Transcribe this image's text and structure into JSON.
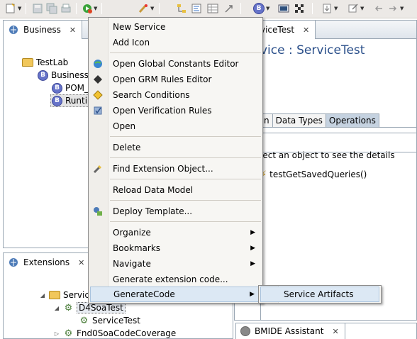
{
  "toolbar": {
    "icons": [
      "new-wizard-icon",
      "save-icon",
      "save-all-icon",
      "print-icon",
      "run-icon",
      "deploy-icon",
      "hierarchy-icon",
      "tree-icon",
      "table-icon",
      "export-icon",
      "bmide-icon",
      "console-icon",
      "checker-icon",
      "import-icon",
      "back-icon",
      "forward-icon"
    ]
  },
  "business_view": {
    "tab_title": "Business",
    "tree": [
      {
        "label": "TestLab"
      },
      {
        "label": "BusinessO"
      },
      {
        "label": "POM_"
      },
      {
        "label": "Runtin"
      }
    ]
  },
  "editor": {
    "tab_title": "viceTest",
    "header": "vice : ServiceTest",
    "tabs": [
      {
        "label": "n"
      },
      {
        "label": "Data Types"
      },
      {
        "label": "Operations"
      }
    ],
    "hint": "lect an object to see the details",
    "operation": "testGetSavedQueries()"
  },
  "extensions_view": {
    "tab_title": "Extensions",
    "tree": [
      {
        "label": "Servic"
      },
      {
        "label": "D4SoaTest"
      },
      {
        "label": "ServiceTest"
      },
      {
        "label": "Fnd0SoaCodeCoverage"
      }
    ]
  },
  "bmide_view": {
    "tab_title": "BMIDE Assistant"
  },
  "context_menu": {
    "items": [
      {
        "label": "New Service"
      },
      {
        "label": "Add Icon"
      },
      {
        "label": "Open Global Constants Editor"
      },
      {
        "label": "Open GRM Rules Editor"
      },
      {
        "label": "Search Conditions"
      },
      {
        "label": "Open Verification Rules"
      },
      {
        "label": "Open"
      },
      {
        "label": "Delete"
      },
      {
        "label": "Find Extension Object..."
      },
      {
        "label": "Reload Data Model"
      },
      {
        "label": "Deploy Template..."
      },
      {
        "label": "Organize"
      },
      {
        "label": "Bookmarks"
      },
      {
        "label": "Navigate"
      },
      {
        "label": "Generate extension code..."
      },
      {
        "label": "GenerateCode"
      }
    ]
  },
  "submenu": {
    "items": [
      {
        "label": "Service Artifacts"
      }
    ]
  },
  "colors": {
    "highlight": "#dce8f4",
    "highlight_border": "#a9c3de",
    "view_border": "#9aa7b4",
    "tab_active": "#c5d2e0"
  }
}
